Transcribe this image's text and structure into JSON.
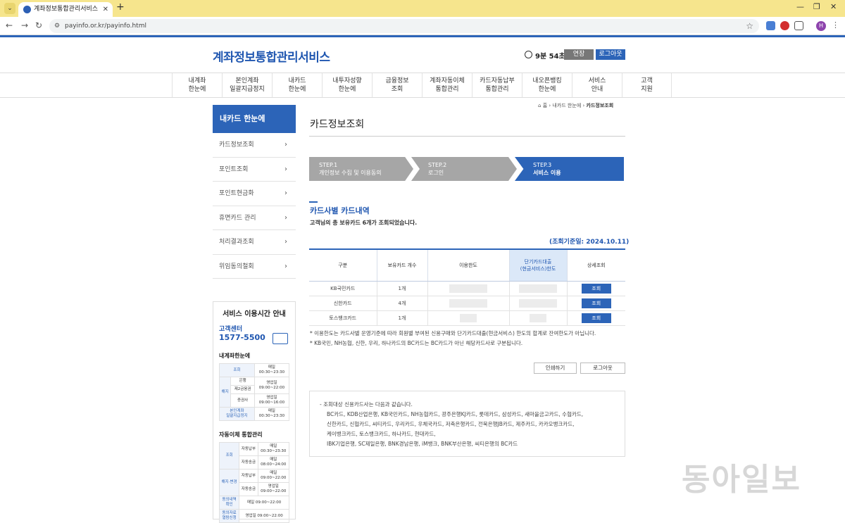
{
  "browser": {
    "tab_title": "계좌정보통합관리서비스",
    "url": "payinfo.or.kr/payinfo.html",
    "avatar": "H"
  },
  "header": {
    "logo": "계좌정보통합관리서비스",
    "timer": "9분 54초",
    "extend_label": "연장",
    "logout_label": "로그아웃"
  },
  "gnb": [
    "내계좌\n한눈에",
    "본인계좌\n일괄지급정지",
    "내카드\n한눈에",
    "내투자성향\n한눈에",
    "금융정보\n조회",
    "계좌자동이체\n통합관리",
    "카드자동납부\n통합관리",
    "내오픈뱅킹\n한눈에",
    "서비스\n안내",
    "고객\n지원"
  ],
  "sidebar": {
    "title": "내카드 한눈에",
    "items": [
      "카드정보조회",
      "포인트조회",
      "포인트현금화",
      "휴면카드 관리",
      "처리결과조회",
      "위임동의철회"
    ]
  },
  "service_hours": {
    "title": "서비스 이용시간 안내",
    "center_label": "고객센터",
    "phone": "1577-5500",
    "section1": "내계좌한눈에",
    "section2": "자동이체 통합관리",
    "t1": {
      "r1a": "조회",
      "r1b": "매일\n00:30~23:30",
      "r2": "해지",
      "r2a": "은행",
      "r2b": "영업일\n09:00~22:00",
      "r3a": "제2금융권",
      "r4a": "증권사",
      "r4b": "영업일\n09:00~16:00",
      "r5a": "본인계좌\n일괄지급정지",
      "r5b": "매일\n00:30~23:30"
    },
    "t2": {
      "r1": "조회",
      "r1a": "자동납부",
      "r1b": "매일\n00:30~23:30",
      "r2a": "자동송금",
      "r2b": "매일\n08:00~24:00",
      "r3": "해지·변경",
      "r3a": "자동납부",
      "r3b": "매일\n09:00~22:00",
      "r4a": "자동송금",
      "r4b": "영업일\n09:00~22:00",
      "r5a": "동의내역\n확인",
      "r5b": "매일 09:00~22:00",
      "r6a": "동의자료\n열람신청",
      "r6b": "영업일 09:00~22:00"
    }
  },
  "breadcrumb": {
    "home": "홈",
    "level1": "내카드 한눈에",
    "current": "카드정보조회"
  },
  "page_title": "카드정보조회",
  "steps": [
    {
      "num": "STEP.1",
      "label": "개인정보 수집 및 이용동의"
    },
    {
      "num": "STEP.2",
      "label": "로그인"
    },
    {
      "num": "STEP.3",
      "label": "서비스 이용"
    }
  ],
  "section": {
    "title": "카드사별 카드내역",
    "desc": "고객님의 총 보유카드 6개가 조회되었습니다.",
    "query_date": "(조회기준일: 2024.10.11)"
  },
  "table": {
    "headers": [
      "구분",
      "보유카드 개수",
      "이용한도",
      "단기카드대출\n(현금서비스)한도",
      "상세조회"
    ],
    "rows": [
      {
        "company": "KB국민카드",
        "count": "1개",
        "detail": "조회"
      },
      {
        "company": "신한카드",
        "count": "4개",
        "detail": "조회"
      },
      {
        "company": "토스뱅크카드",
        "count": "1개",
        "detail": "조회"
      }
    ]
  },
  "notes": [
    "* 이용한도는 카드사별 운영기준에 따라 회원별 부여된 신용구매와 단기카드대출(현금서비스) 한도의 합계로 잔여한도가 아닙니다.",
    "* KB국민, NH농협, 신한, 우리, 하나카드의 BC카드는 BC카드가 아닌 해당카드사로 구분됩니다."
  ],
  "buttons": {
    "print": "인쇄하기",
    "logout": "로그아웃"
  },
  "info": {
    "intro": "- 조회대상 신용카드사는 다음과 같습니다.",
    "lines": [
      "BC카드, KDB산업은행, KB국민카드, NH농협카드, 광주은행KJ카드, 롯데카드, 삼성카드, 새마을금고카드, 수협카드,",
      "신한카드, 신협카드, 씨티카드, 우리카드, 우체국카드, 저축은행카드, 전북은행JB카드, 제주카드, 카카오뱅크카드,",
      "케이뱅크카드, 토스뱅크카드, 하나카드, 현대카드,",
      "IBK기업은행, SC제일은행, BNK경남은행, iM뱅크, BNK부산은행, 씨티은행의 BC카드"
    ]
  },
  "watermark": "동아일보"
}
